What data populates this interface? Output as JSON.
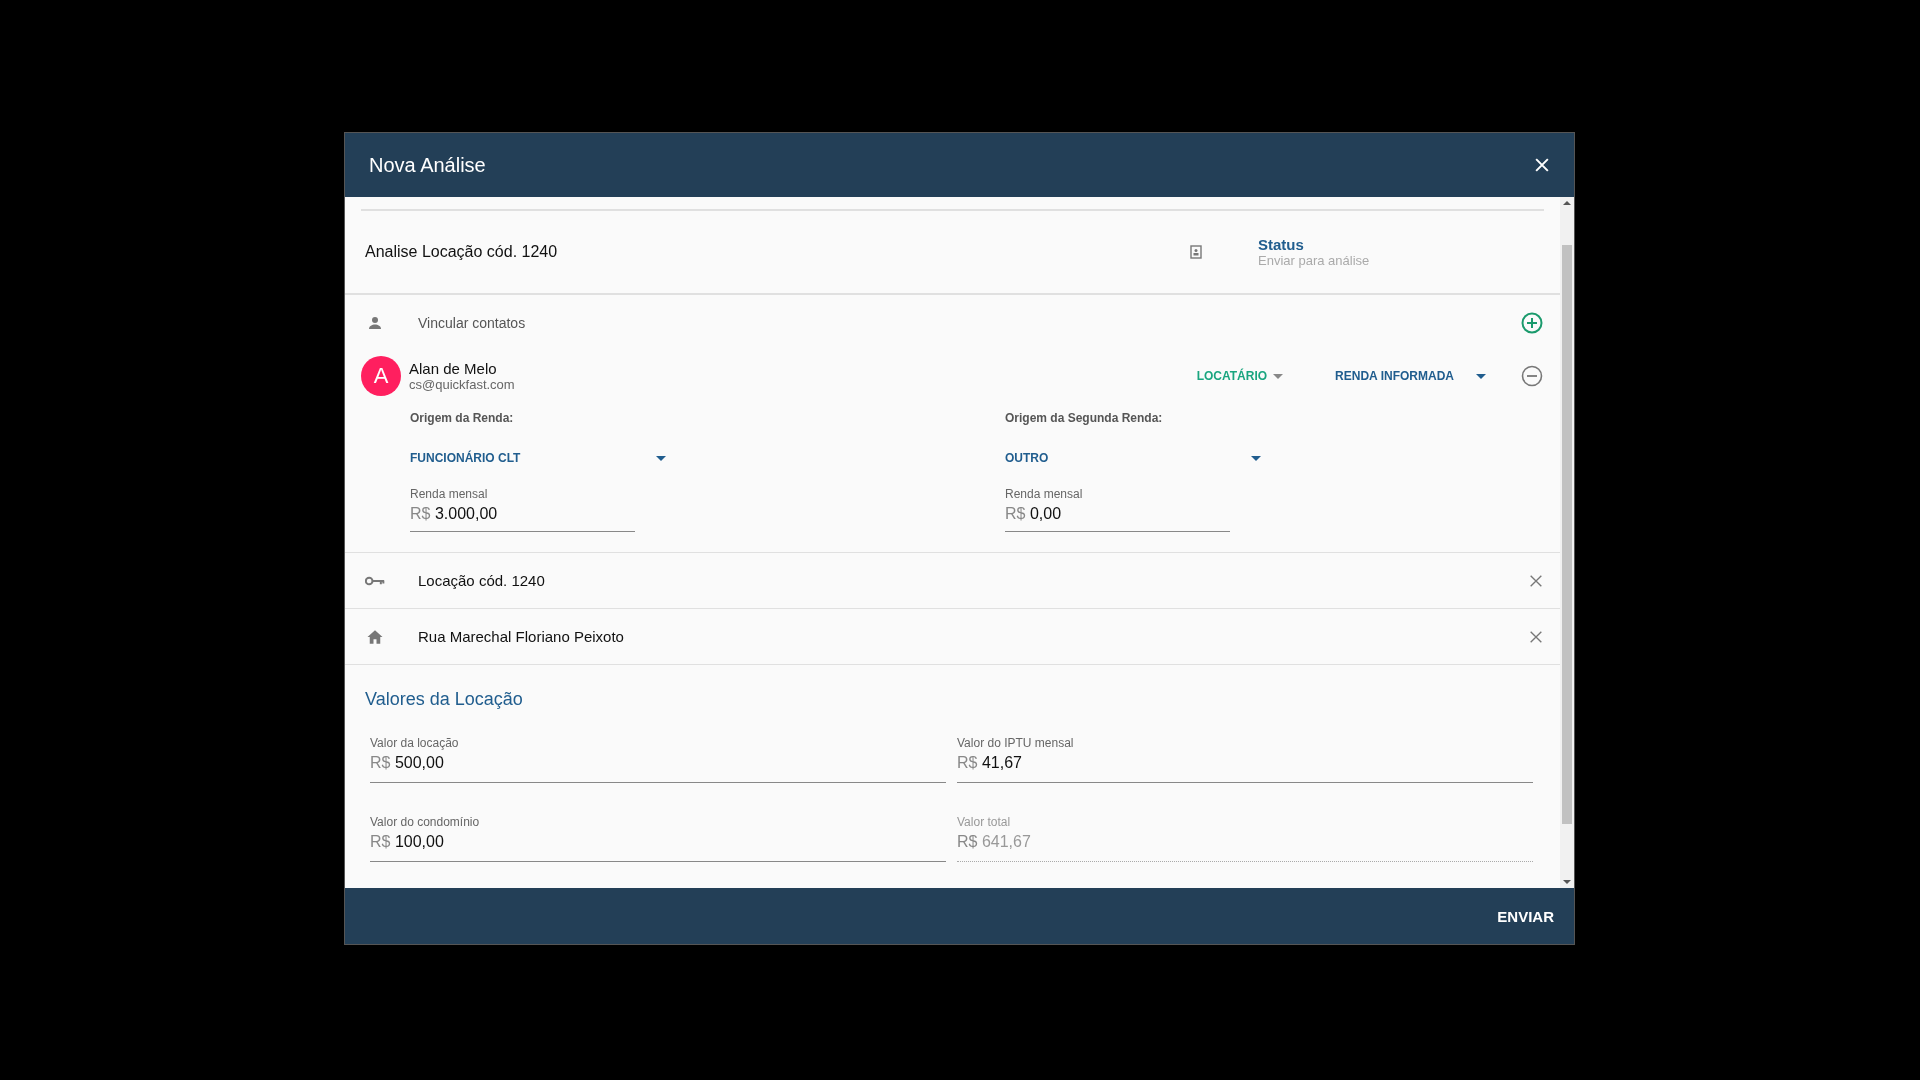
{
  "dialog": {
    "title": "Nova Análise"
  },
  "record": {
    "title": "Analise Locação cód. 1240",
    "status_label": "Status",
    "status_value": "Enviar para análise"
  },
  "contacts": {
    "label": "Vincular contatos",
    "items": [
      {
        "initial": "A",
        "color": "#ff1f5f",
        "name": "Alan de Melo",
        "email": "cs@quickfast.com",
        "role": "LOCATÁRIO",
        "income_type": "RENDA INFORMADA",
        "incomes": [
          {
            "label": "Origem da Renda:",
            "source": "FUNCIONÁRIO CLT",
            "amount_label": "Renda mensal",
            "currency": "R$",
            "amount": "3.000,00"
          },
          {
            "label": "Origem da Segunda Renda:",
            "source": "OUTRO",
            "amount_label": "Renda mensal",
            "currency": "R$",
            "amount": "0,00"
          }
        ]
      }
    ]
  },
  "links": [
    {
      "kind": "key",
      "text": "Locação cód. 1240"
    },
    {
      "kind": "home",
      "text": "Rua Marechal Floriano Peixoto"
    }
  ],
  "values": {
    "title": "Valores da Locação",
    "fields": [
      {
        "label": "Valor da locação",
        "currency": "R$",
        "value": "500,00",
        "disabled": false
      },
      {
        "label": "Valor do IPTU mensal",
        "currency": "R$",
        "value": "41,67",
        "disabled": false
      },
      {
        "label": "Valor do condomínio",
        "currency": "R$",
        "value": "100,00",
        "disabled": false
      },
      {
        "label": "Valor total",
        "currency": "R$",
        "value": "641,67",
        "disabled": true
      }
    ]
  },
  "footer": {
    "button": "ENVIAR"
  }
}
